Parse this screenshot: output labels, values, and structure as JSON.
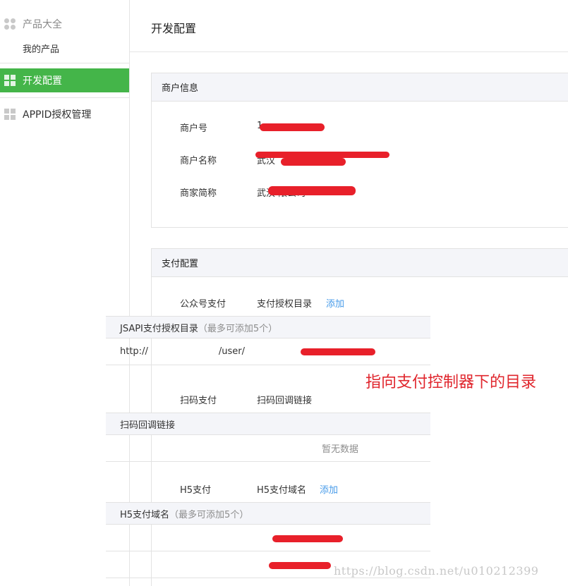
{
  "sidebar": {
    "section_label": "产品大全",
    "sub_item": "我的产品",
    "items": [
      {
        "label": "开发配置",
        "active": true
      },
      {
        "label": "APPID授权管理",
        "active": false
      }
    ]
  },
  "page": {
    "title": "开发配置"
  },
  "merchant_panel": {
    "header": "商户信息",
    "rows": [
      {
        "label": "商户号",
        "value": "1"
      },
      {
        "label": "商户名称",
        "value": "武汉"
      },
      {
        "label": "商家简称",
        "value": "武汉 限公司"
      }
    ]
  },
  "payment_panel": {
    "header": "支付配置",
    "sections": [
      {
        "label": "公众号支付",
        "sub_label": "支付授权目录",
        "action": "添加",
        "table_header": "JSAPI支付授权目录",
        "table_hint": "（最多可添加5个）",
        "rows": [
          "http://",
          "/user/"
        ]
      },
      {
        "label": "扫码支付",
        "sub_label": "扫码回调链接",
        "table_header": "扫码回调链接",
        "empty_text": "暂无数据"
      },
      {
        "label": "H5支付",
        "sub_label": "H5支付域名",
        "action": "添加",
        "table_header": "H5支付域名",
        "table_hint": "（最多可添加5个）"
      }
    ]
  },
  "annotation": "指向支付控制器下的目录",
  "watermark": "https://blog.csdn.net/u010212399",
  "colors": {
    "accent_green": "#44b549",
    "link_blue": "#459ae9",
    "redaction_red": "#e8202a",
    "annotation_red": "#e0262d"
  }
}
